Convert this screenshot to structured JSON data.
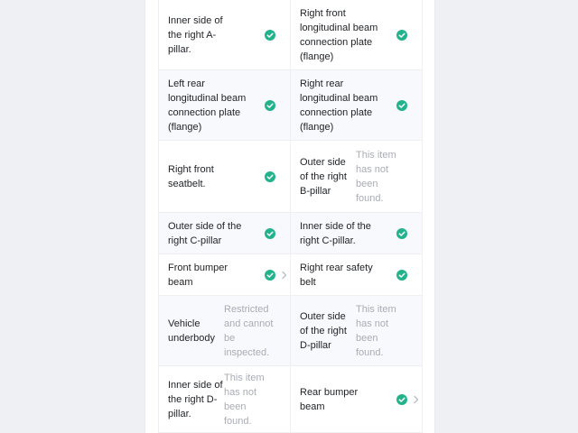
{
  "checklist": {
    "not_found_text": "This item has not been found.",
    "restricted_text": "Restricted and cannot be inspected.",
    "items": [
      {
        "label": "Inner side of the right A-pillar.",
        "status": "passed"
      },
      {
        "label": "Right front longitudinal beam connection plate (flange)",
        "status": "passed"
      },
      {
        "label": "Left rear longitudinal beam connection plate (flange)",
        "status": "passed"
      },
      {
        "label": "Right rear longitudinal beam connection plate (flange)",
        "status": "passed"
      },
      {
        "label": "Right front seatbelt.",
        "status": "passed"
      },
      {
        "label": "Outer side of the right B-pillar",
        "status": "not_found"
      },
      {
        "label": "Outer side of the right C-pillar",
        "status": "passed"
      },
      {
        "label": "Inner side of the right C-pillar.",
        "status": "passed"
      },
      {
        "label": "Front bumper beam",
        "status": "passed"
      },
      {
        "label": "Right rear safety belt",
        "status": "passed"
      },
      {
        "label": "Vehicle underbody",
        "status": "restricted"
      },
      {
        "label": "Outer side of the right D-pillar",
        "status": "not_found"
      },
      {
        "label": "Inner side of the right D-pillar.",
        "status": "not_found"
      },
      {
        "label": "Rear bumper beam",
        "status": "passed"
      }
    ]
  },
  "colors": {
    "check": "#23b38c",
    "note_text": "#a9adb4",
    "label_text": "#222428"
  },
  "icons": {
    "passed": "check-circle-icon",
    "expand": "chevron-right-icon"
  }
}
